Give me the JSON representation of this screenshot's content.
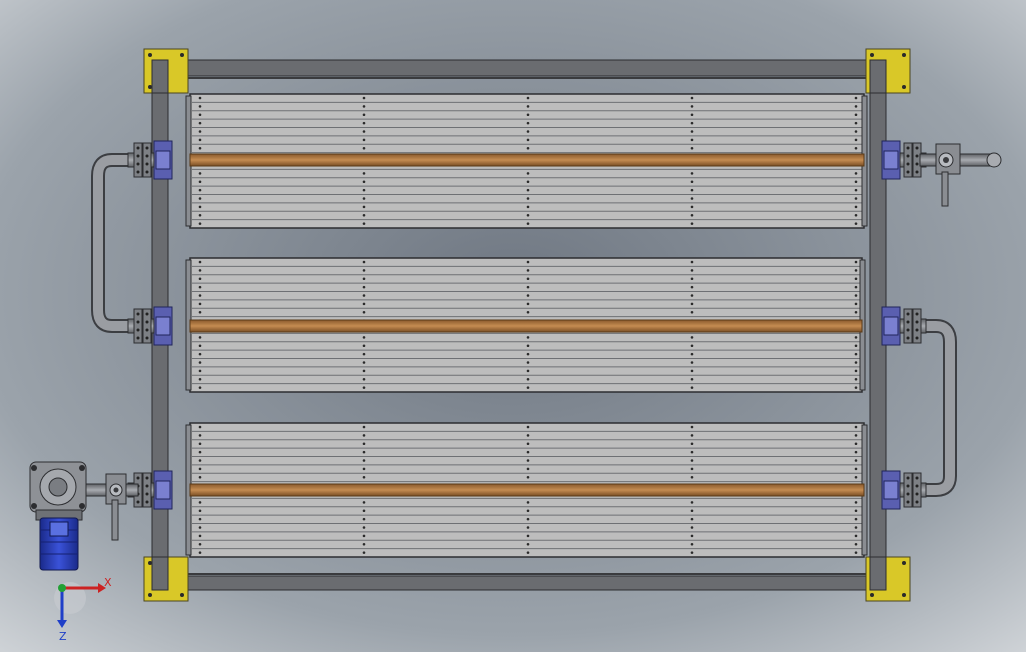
{
  "viewport": {
    "background_top": "#a3aab1",
    "background_bottom": "#d8dbde"
  },
  "triad": {
    "x_label": "X",
    "z_label": "Z",
    "x_color": "#cc2222",
    "z_color": "#1f3fc8",
    "y_color": "#22a035"
  },
  "colors": {
    "frame": "#6e7074",
    "bracket": "#d8c830",
    "copper": "#b07840",
    "panel": "#bcbcbc",
    "flange": "#5a5fb0",
    "motor": "#2b3fb8",
    "pipe": "#8e9196"
  }
}
